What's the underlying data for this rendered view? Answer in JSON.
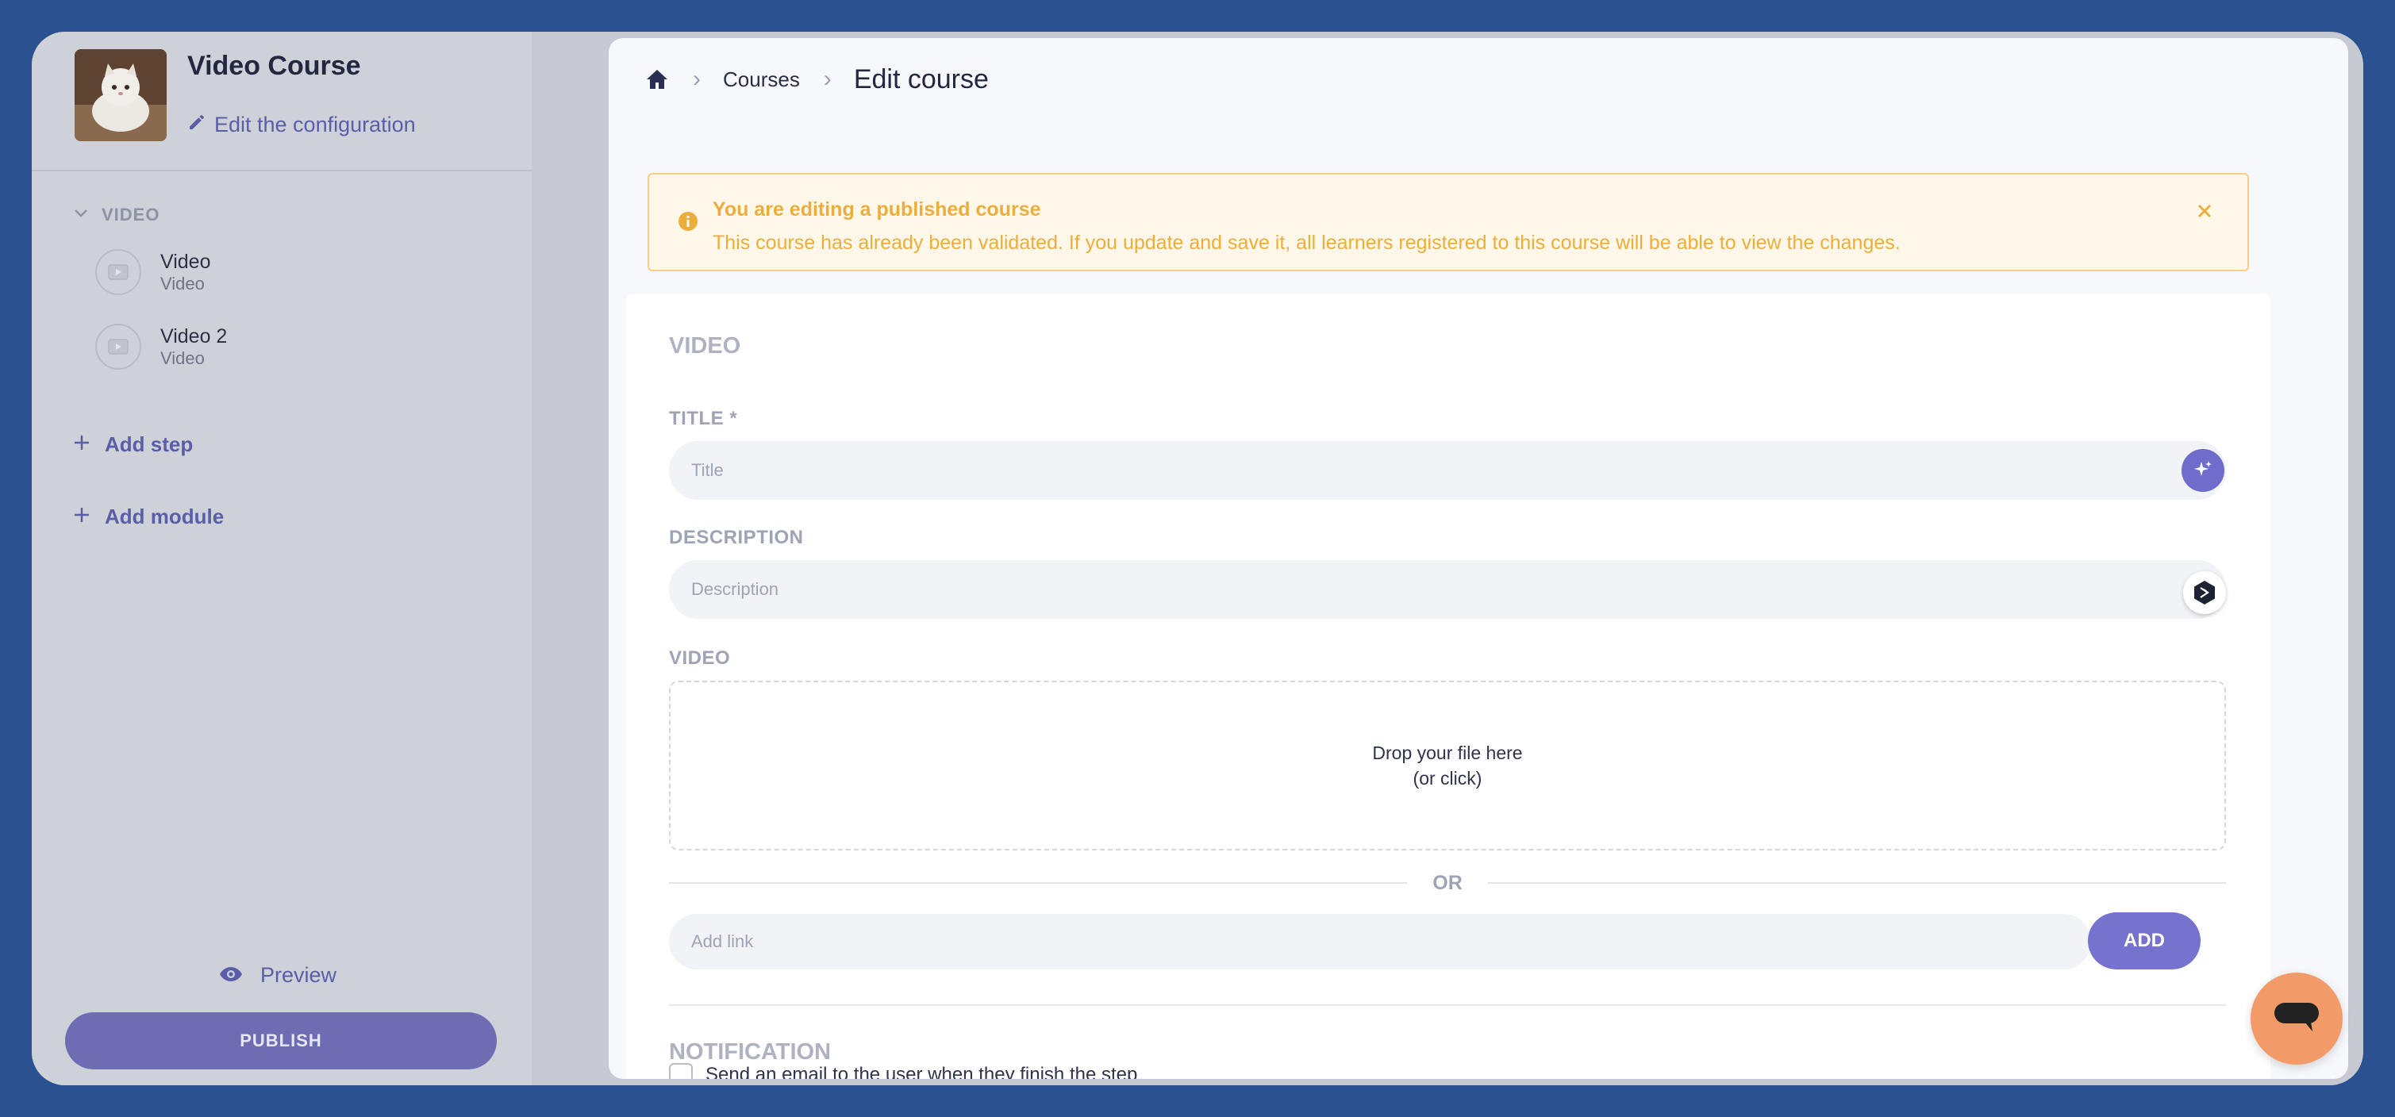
{
  "sidebar": {
    "course_title": "Video Course",
    "edit_config_label": "Edit the configuration",
    "module": {
      "label": "VIDEO",
      "steps": [
        {
          "title": "Video",
          "type": "Video"
        },
        {
          "title": "Video 2",
          "type": "Video"
        }
      ]
    },
    "add_step_label": "Add step",
    "add_module_label": "Add module",
    "preview_label": "Preview",
    "publish_label": "PUBLISH"
  },
  "breadcrumb": {
    "home_icon": "home-icon",
    "courses_label": "Courses",
    "current": "Edit course"
  },
  "banner": {
    "title": "You are editing a published course",
    "message": "This course has already been validated. If you update and save it, all learners registered to this course will be able to view the changes."
  },
  "form": {
    "section_title": "VIDEO",
    "title_label": "TITLE *",
    "title_placeholder": "Title",
    "description_label": "DESCRIPTION",
    "description_placeholder": "Description",
    "video_label": "VIDEO",
    "dropzone_line1": "Drop your file here",
    "dropzone_line2": "(or click)",
    "or_label": "OR",
    "link_placeholder": "Add link",
    "add_label": "ADD",
    "notification_title": "NOTIFICATION",
    "notify_checkbox_label": "Send an email to the user when they finish the step"
  },
  "colors": {
    "background": "#2c5191",
    "accent": "#6e6db4",
    "warning": "#ecae3a",
    "chat": "#f39a69"
  }
}
